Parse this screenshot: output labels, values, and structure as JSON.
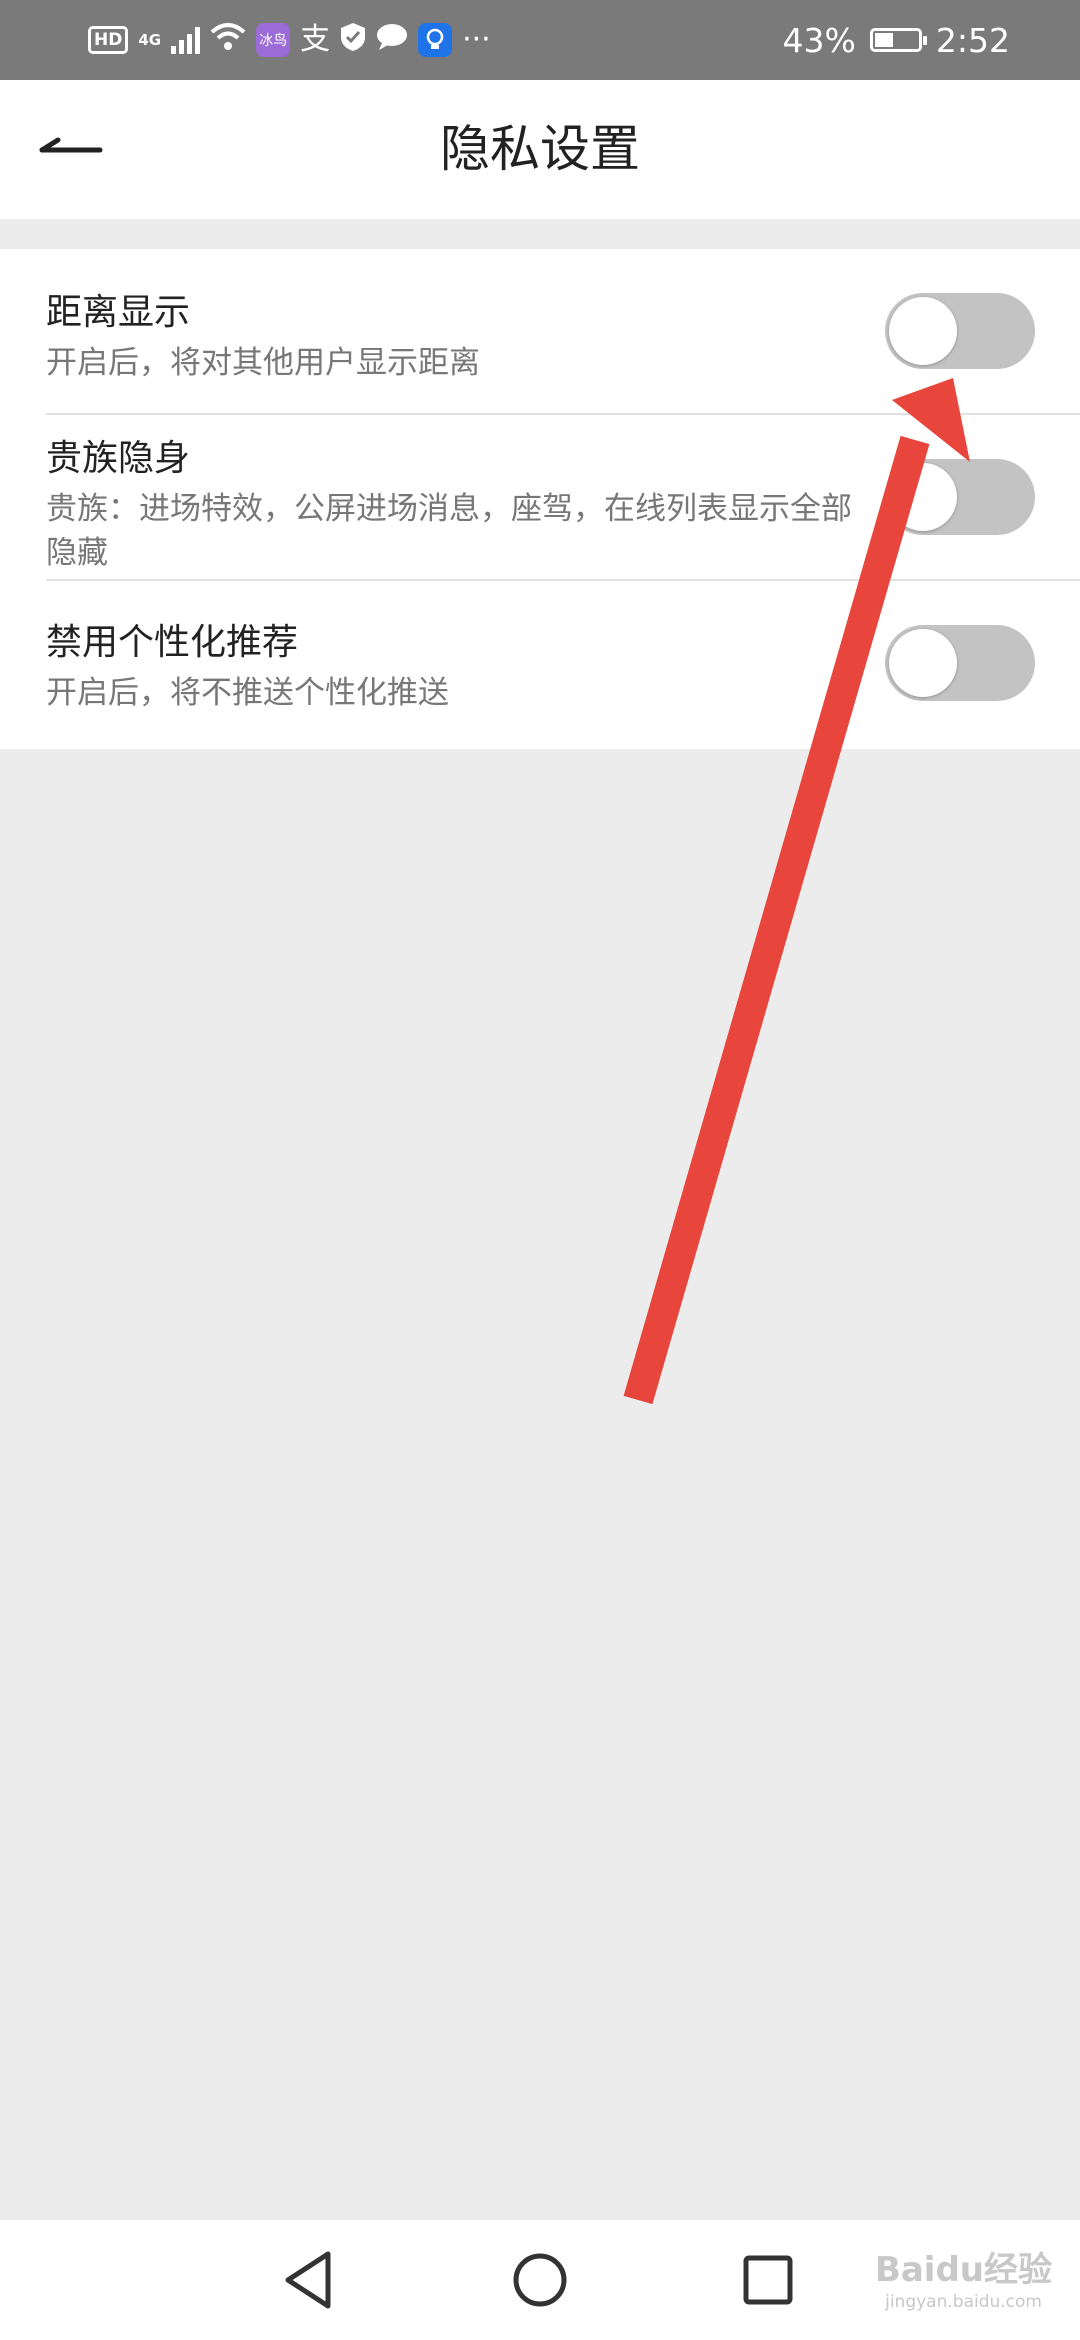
{
  "status_bar": {
    "hd": "HD",
    "network": "4G",
    "app_badge_text": "冰鸟",
    "battery_percent": "43%",
    "battery_level": 0.43,
    "time": "2:52",
    "more": "···"
  },
  "header": {
    "title": "隐私设置"
  },
  "settings": [
    {
      "title": "距离显示",
      "subtitle": "开启后，将对其他用户显示距离",
      "enabled": false
    },
    {
      "title": "贵族隐身",
      "subtitle": "贵族：进场特效，公屏进场消息，座驾，在线列表显示全部隐藏",
      "enabled": false
    },
    {
      "title": "禁用个性化推荐",
      "subtitle": "开启后，将不推送个性化推送",
      "enabled": false
    }
  ],
  "watermark": {
    "brand": "Baidu经验",
    "url": "jingyan.baidu.com"
  },
  "colors": {
    "toggle_off": "#c3c3c3",
    "annotation_arrow": "#e8453c",
    "background": "#ececec"
  }
}
